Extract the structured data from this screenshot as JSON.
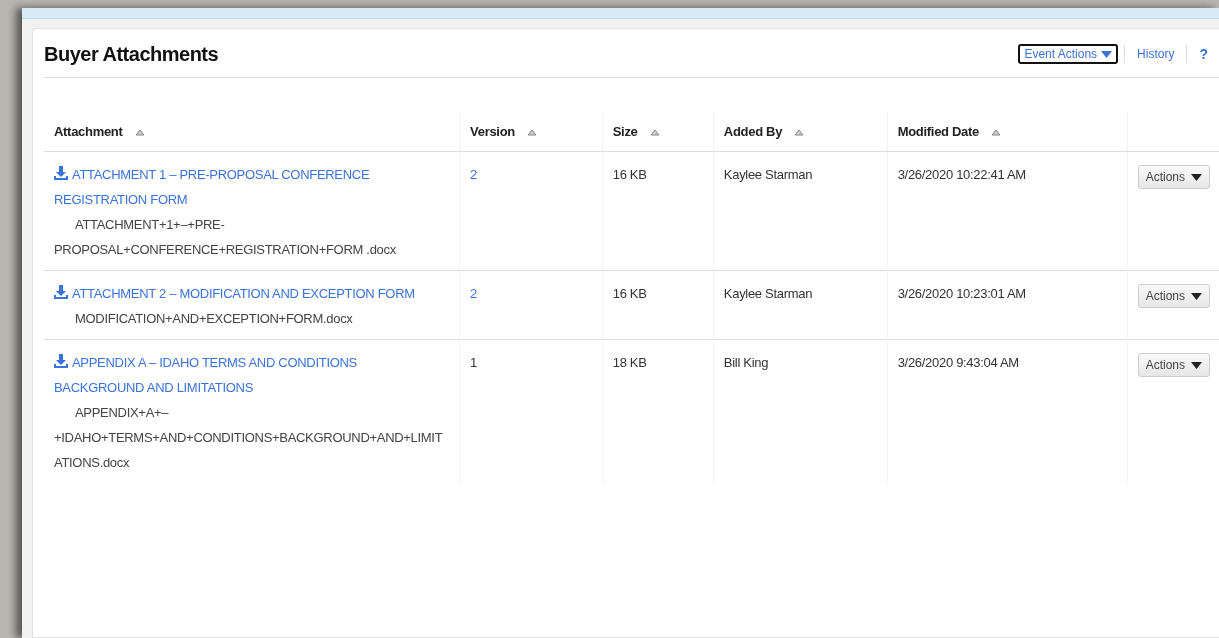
{
  "panel": {
    "title": "Buyer Attachments",
    "header_links": [
      {
        "kind": "menu",
        "label": "Event Actions",
        "focused": true
      },
      {
        "kind": "link",
        "label": "History",
        "focused": false
      },
      {
        "kind": "help",
        "label": "?",
        "focused": false
      }
    ]
  },
  "table": {
    "columns": [
      "Attachment",
      "Version",
      "Size",
      "Added By",
      "Modified Date"
    ],
    "rows": [
      {
        "title": "ATTACHMENT 1 – PRE-PROPOSAL CONFERENCE REGISTRATION FORM",
        "file": "ATTACHMENT+1+–+PRE-PROPOSAL+CONFERENCE+REGISTRATION+FORM .docx",
        "version": "2",
        "version_link": true,
        "size": "16 KB",
        "added_by": "Kaylee Starman",
        "modified": "3/26/2020 10:22:41 AM",
        "action": "Actions"
      },
      {
        "title": "ATTACHMENT 2 – MODIFICATION AND EXCEPTION FORM",
        "file": "MODIFICATION+AND+EXCEPTION+FORM.docx",
        "version": "2",
        "version_link": true,
        "size": "16 KB",
        "added_by": "Kaylee Starman",
        "modified": "3/26/2020 10:23:01 AM",
        "action": "Actions"
      },
      {
        "title": "APPENDIX A – IDAHO TERMS AND CONDITIONS BACKGROUND AND LIMITATIONS",
        "file": "APPENDIX+A+–​+IDAHO+TERMS+AND+CONDITIONS+BACKGROUND+AND+LIMITATIONS.docx",
        "version": "1",
        "version_link": false,
        "size": "18 KB",
        "added_by": "Bill King",
        "modified": "3/26/2020 9:43:04 AM",
        "action": "Actions"
      }
    ]
  }
}
